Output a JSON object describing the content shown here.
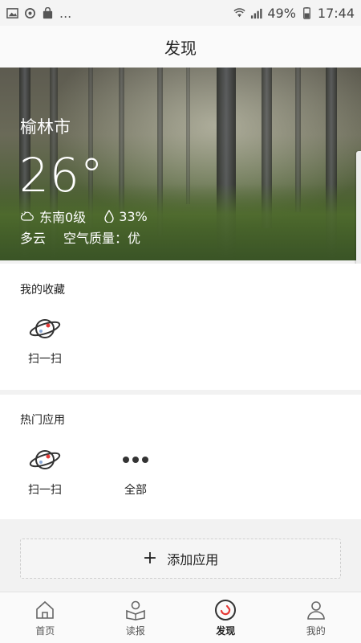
{
  "status_bar": {
    "battery": "49%",
    "time": "17:44",
    "dots": "..."
  },
  "title": "发现",
  "weather": {
    "city": "榆林市",
    "temperature": "26°",
    "wind": "东南0级",
    "humidity": "33%",
    "condition": "多云",
    "air_quality": "空气质量：优"
  },
  "favorites": {
    "heading": "我的收藏",
    "items": [
      {
        "label": "扫一扫",
        "icon": "planet-icon"
      }
    ]
  },
  "hot_apps": {
    "heading": "热门应用",
    "items": [
      {
        "label": "扫一扫",
        "icon": "planet-icon"
      },
      {
        "label": "全部",
        "icon": "more-dots-icon"
      }
    ]
  },
  "add_app": {
    "label": "添加应用"
  },
  "tabbar": {
    "active": "发现",
    "tabs": [
      {
        "label": "首页",
        "icon": "home-icon"
      },
      {
        "label": "读报",
        "icon": "reader-icon"
      },
      {
        "label": "发现",
        "icon": "discover-icon"
      },
      {
        "label": "我的",
        "icon": "profile-icon"
      }
    ]
  },
  "colors": {
    "accent": "#e53935",
    "text": "#222222",
    "background": "#f2f2f2"
  }
}
